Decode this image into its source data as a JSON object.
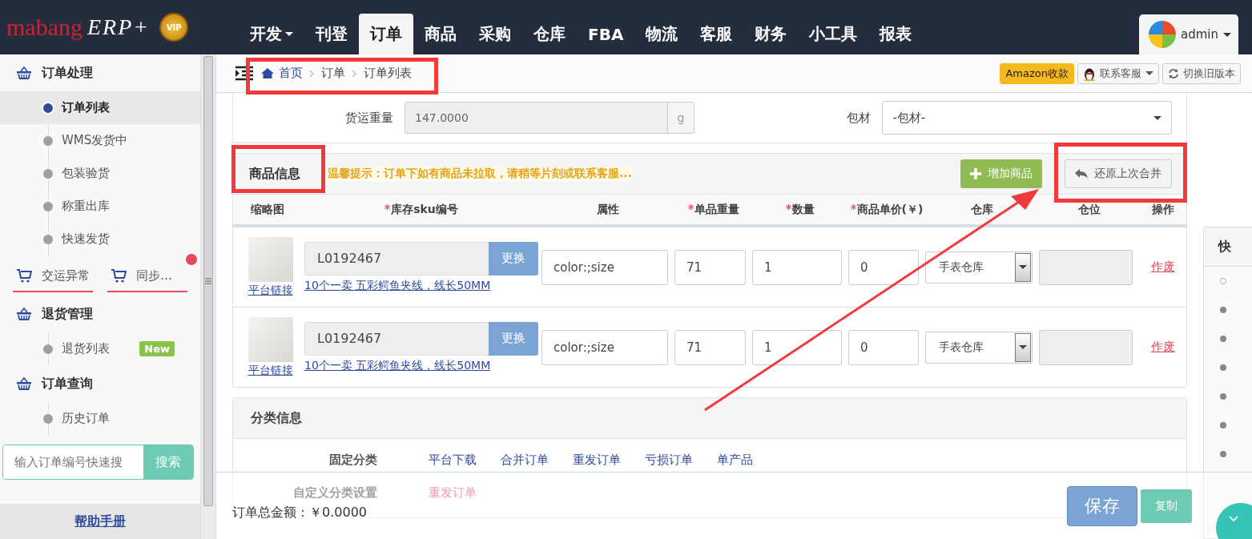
{
  "logo": {
    "brand": "mabang",
    "product": "ERP+",
    "badge": "VIP"
  },
  "nav": [
    {
      "label": "开发",
      "dropdown": true,
      "selected": false
    },
    {
      "label": "刊登",
      "dropdown": false,
      "selected": false
    },
    {
      "label": "订单",
      "dropdown": false,
      "selected": true
    },
    {
      "label": "商品",
      "dropdown": false,
      "selected": false
    },
    {
      "label": "采购",
      "dropdown": false,
      "selected": false
    },
    {
      "label": "仓库",
      "dropdown": false,
      "selected": false
    },
    {
      "label": "FBA",
      "dropdown": false,
      "selected": false
    },
    {
      "label": "物流",
      "dropdown": false,
      "selected": false
    },
    {
      "label": "客服",
      "dropdown": false,
      "selected": false
    },
    {
      "label": "财务",
      "dropdown": false,
      "selected": false
    },
    {
      "label": "小工具",
      "dropdown": false,
      "selected": false
    },
    {
      "label": "报表",
      "dropdown": false,
      "selected": false
    }
  ],
  "user": {
    "name": "admin"
  },
  "sidebar": {
    "blocks": [
      {
        "kind": "section",
        "title": "订单处理",
        "items": [
          {
            "label": "订单列表",
            "selected": true
          },
          {
            "label": "WMS发货中",
            "selected": false
          },
          {
            "label": "包装验货",
            "selected": false
          },
          {
            "label": "称重出库",
            "selected": false
          },
          {
            "label": "快速发货",
            "selected": false
          }
        ]
      },
      {
        "kind": "shortcuts",
        "items": [
          {
            "label": "交运异常",
            "alert": false
          },
          {
            "label": "同步…",
            "alert": true
          }
        ]
      },
      {
        "kind": "section",
        "title": "退货管理",
        "items": [
          {
            "label": "退货列表",
            "selected": false,
            "badge": "New"
          }
        ]
      },
      {
        "kind": "section",
        "title": "订单查询",
        "items": [
          {
            "label": "历史订单",
            "selected": false
          }
        ]
      }
    ],
    "search": {
      "placeholder": "输入订单编号快速搜",
      "button": "搜索"
    },
    "help_link": "帮助手册"
  },
  "breadcrumb": [
    "首页",
    "订单",
    "订单列表"
  ],
  "toolbar": {
    "amazon": "Amazon收款",
    "support": "联系客服",
    "switch": "切换旧版本"
  },
  "shipping": {
    "weight_label": "货运重量",
    "weight_value": "147.0000",
    "unit": "g",
    "material_label": "包材",
    "material_value": "-包材-"
  },
  "products": {
    "title": "商品信息",
    "notice": "温馨提示：订单下如有商品未拉取，请稍等片刻或联系客服...",
    "add_button": "增加商品",
    "restore_button": "还原上次合并",
    "columns": [
      {
        "label": "缩略图",
        "required": false
      },
      {
        "label": "库存sku编号",
        "required": true
      },
      {
        "label": "属性",
        "required": false
      },
      {
        "label": "单品重量",
        "required": true
      },
      {
        "label": "数量",
        "required": true
      },
      {
        "label": "商品单价(￥)",
        "required": true
      },
      {
        "label": "仓库",
        "required": false
      },
      {
        "label": "仓位",
        "required": false
      },
      {
        "label": "操作",
        "required": false
      }
    ],
    "rows": [
      {
        "platform_link": "平台链接",
        "sku": "L0192467",
        "replace": "更换",
        "title": "10个一卖 五彩鳄鱼夹线，线长50MM",
        "attribute": "color:;size",
        "weight": "71",
        "quantity": "1",
        "price": "0",
        "warehouse": "手表仓库",
        "action": "作废"
      },
      {
        "platform_link": "平台链接",
        "sku": "L0192467",
        "replace": "更换",
        "title": "10个一卖 五彩鳄鱼夹线，线长50MM",
        "attribute": "color:;size",
        "weight": "71",
        "quantity": "1",
        "price": "0",
        "warehouse": "手表仓库",
        "action": "作废"
      }
    ]
  },
  "classification": {
    "title": "分类信息",
    "fixed_label": "固定分类",
    "fixed_items": [
      "平台下载",
      "合并订单",
      "重发订单",
      "亏损订单",
      "单产品"
    ],
    "custom_label": "自定义分类设置",
    "custom_items": [
      "重发订单"
    ]
  },
  "footer": {
    "total_label": "订单总金额：",
    "total": "￥0.0000",
    "save": "保存",
    "copy": "复制"
  },
  "side_panel": {
    "title": "快"
  }
}
